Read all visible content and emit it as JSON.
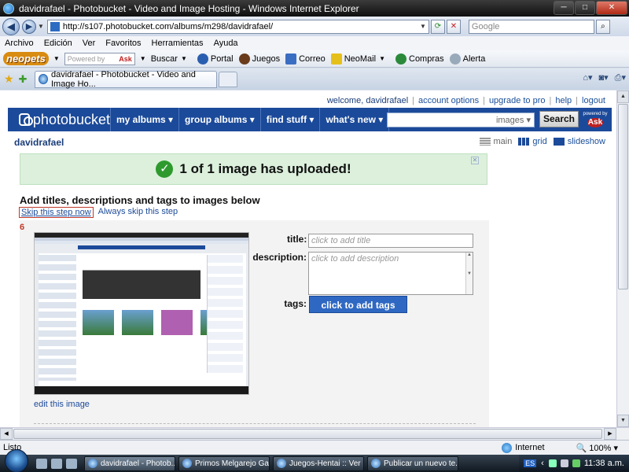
{
  "window": {
    "title": "davidrafael - Photobucket - Video and Image Hosting - Windows Internet Explorer",
    "minimize": "─",
    "maximize": "□",
    "close": "✕"
  },
  "address": {
    "url": "http://s107.photobucket.com/albums/m298/davidrafael/",
    "search_placeholder": "Google"
  },
  "menu": [
    "Archivo",
    "Edición",
    "Ver",
    "Favoritos",
    "Herramientas",
    "Ayuda"
  ],
  "neopets_toolbar": {
    "logo": "neopets",
    "powered": "Powered by",
    "ask": "Ask",
    "items": [
      "Buscar",
      "Portal",
      "Juegos",
      "Correo",
      "NeoMail",
      "Compras",
      "Alerta"
    ]
  },
  "tab": {
    "label": "davidrafael - Photobucket - Video and Image Ho..."
  },
  "photobucket": {
    "links": {
      "welcome": "welcome, davidrafael",
      "account": "account options",
      "upgrade": "upgrade to pro",
      "help": "help",
      "logout": "logout"
    },
    "logo": "photobucket",
    "nav": [
      "my albums ▾",
      "group albums ▾",
      "find stuff ▾",
      "what's new ▾"
    ],
    "search_scope": "images ▾",
    "search_button": "Search",
    "powered_by": "powered by",
    "ask": "Ask",
    "album": "davidrafael",
    "views": {
      "main": "main",
      "grid": "grid",
      "slideshow": "slideshow"
    },
    "banner": "1 of 1 image has uploaded!",
    "heading": "Add titles, descriptions and tags to images below",
    "skip_now": "Skip this step now",
    "always_skip": "Always skip this step",
    "image_number": "6",
    "edit_link": "edit this image",
    "title_label": "title:",
    "title_placeholder": "click to add title",
    "description_label": "description:",
    "description_placeholder": "click to add description",
    "tags_label": "tags:",
    "tags_button": "click to add tags"
  },
  "status": {
    "text": "Listo",
    "zone": "Internet",
    "zoom": "100%"
  },
  "taskbar": {
    "tasks": [
      "davidrafael - Photob...",
      "Primos Melgarejo Ga...",
      "Juegos-Hentai :: Ver ...",
      "Publicar un nuevo te..."
    ],
    "lang": "ES",
    "clock": "11:38 a.m."
  }
}
